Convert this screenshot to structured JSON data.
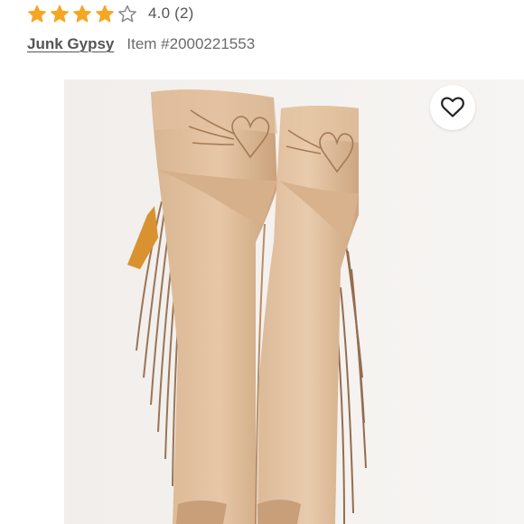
{
  "rating": {
    "value": 4,
    "max": 5,
    "text": "4.0 (2)",
    "star_color": "#f5a623"
  },
  "listing": {
    "brand": "Junk Gypsy",
    "item_number": "Item #2000221553"
  },
  "photo": {
    "subject": "Tan suede over-the-knee fringe boots with heart-and-wings stitching"
  },
  "like_button": {
    "icon": "heart-outline-icon"
  }
}
